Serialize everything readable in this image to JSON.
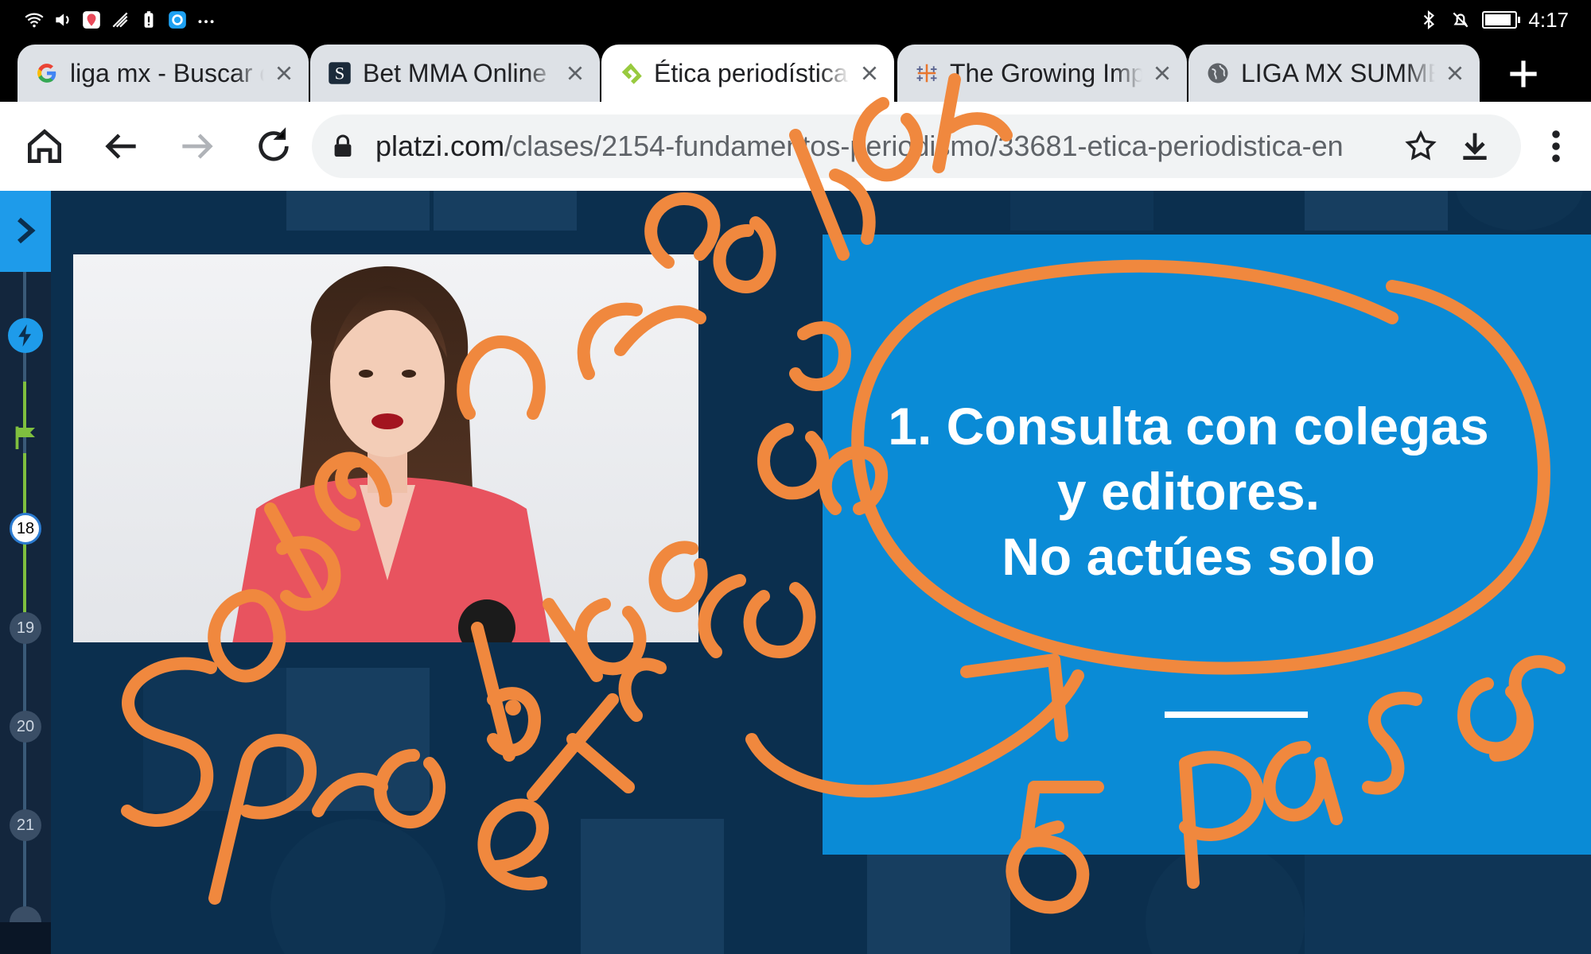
{
  "status_bar": {
    "time": "4:17",
    "left_icons": [
      "wifi-icon",
      "volume-icon",
      "location-icon",
      "signal-icon",
      "battery-alert-icon",
      "app-icon",
      "more-icon"
    ],
    "right_icons": [
      "bluetooth-icon",
      "mute-icon",
      "battery-icon"
    ],
    "battery_level": 0.8
  },
  "tabs": [
    {
      "title": "liga mx - Buscar con Google",
      "favicon": "google-icon",
      "active": false
    },
    {
      "title": "Bet MMA Online",
      "favicon": "s-logo-icon",
      "active": false
    },
    {
      "title": "Ética periodística en la cobertura",
      "favicon": "platzi-icon",
      "active": true
    },
    {
      "title": "The Growing Impact",
      "favicon": "tableau-icon",
      "active": false
    },
    {
      "title": "LIGA MX SUMMER",
      "favicon": "globe-icon",
      "active": false
    }
  ],
  "toolbar": {
    "url_host": "platzi.com",
    "url_path": "/clases/2154-fundamentos-periodismo/33681-etica-periodistica-en"
  },
  "sidebar": {
    "nodes": [
      "18",
      "19",
      "20",
      "21"
    ]
  },
  "slide": {
    "lines": [
      "1. Consulta con colegas",
      "y editores.",
      "No actúes solo"
    ]
  },
  "annotations": {
    "words": [
      "Sobre",
      "resolver",
      "Problemas",
      "éticos",
      "5 Pasos"
    ],
    "color": "#f0883e"
  },
  "colors": {
    "page_bg": "#0b2f4e",
    "slide_bg": "#0a8bd6",
    "sidebar_accent": "#1e9bea",
    "progress_green": "#7fbf3f"
  }
}
